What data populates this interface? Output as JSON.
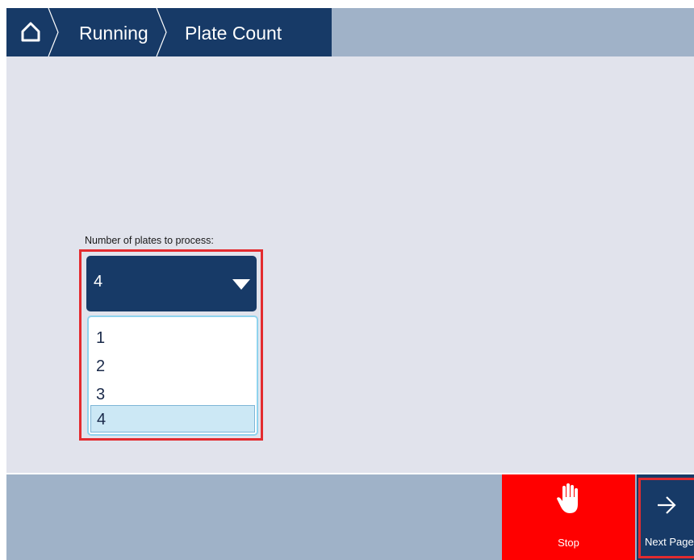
{
  "header": {
    "home_icon": "home-icon",
    "breadcrumbs": [
      "Running",
      "Plate Count"
    ]
  },
  "plates": {
    "label": "Number of plates to process:",
    "selected": "4",
    "options": [
      "1",
      "2",
      "3",
      "4"
    ]
  },
  "footer": {
    "stop_label": "Stop",
    "stop_icon": "hand-icon",
    "next_label": "Next Page",
    "next_icon": "arrow-right-icon"
  },
  "colors": {
    "navy": "#173a67",
    "stop_red": "#ff0000",
    "highlight_red": "#e32b2f",
    "option_selected": "#cce8f5"
  }
}
